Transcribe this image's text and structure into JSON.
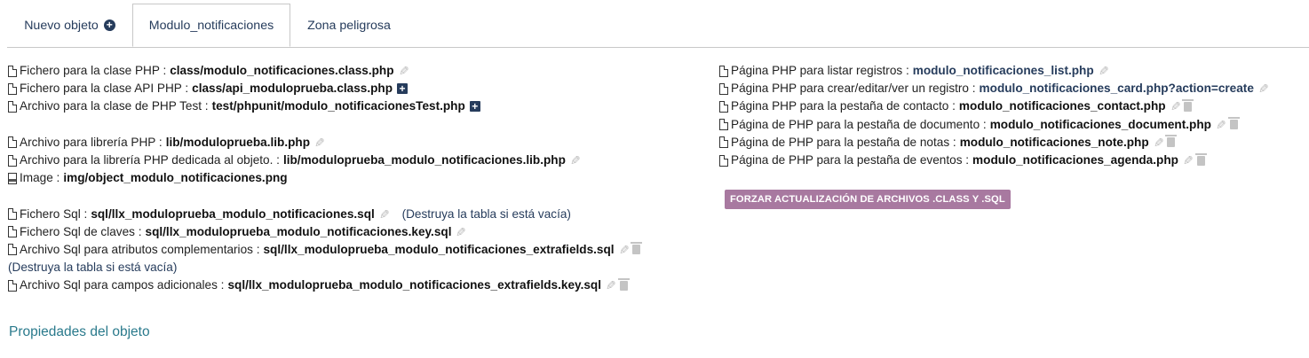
{
  "tabs": [
    {
      "label": "Nuevo objeto",
      "icon": "plus-circle-icon"
    },
    {
      "label": "Modulo_notificaciones",
      "active": true
    },
    {
      "label": "Zona peligrosa"
    }
  ],
  "left": {
    "class_php": {
      "label": "Fichero para la clase PHP :",
      "value": "class/modulo_notificaciones.class.php"
    },
    "class_api": {
      "label": "Fichero para la clase API PHP :",
      "value": "class/api_moduloprueba.class.php"
    },
    "class_test": {
      "label": "Archivo para la clase de PHP Test :",
      "value": "test/phpunit/modulo_notificacionesTest.php"
    },
    "lib": {
      "label": "Archivo para librería PHP :",
      "value": "lib/moduloprueba.lib.php"
    },
    "lib_obj": {
      "label": "Archivo para la librería PHP dedicada al objeto. :",
      "value": "lib/moduloprueba_modulo_notificaciones.lib.php"
    },
    "image": {
      "label": "Image :",
      "value": "img/object_modulo_notificaciones.png"
    },
    "sql": {
      "label": "Fichero Sql :",
      "value": "sql/llx_moduloprueba_modulo_notificaciones.sql",
      "note": "(Destruya la tabla si está vacía)"
    },
    "sql_key": {
      "label": "Fichero Sql de claves :",
      "value": "sql/llx_moduloprueba_modulo_notificaciones.key.sql"
    },
    "sql_extra": {
      "label": "Archivo Sql para atributos complementarios :",
      "value": "sql/llx_moduloprueba_modulo_notificaciones_extrafields.sql",
      "note": "(Destruya la tabla si está vacía)"
    },
    "sql_extra_key": {
      "label": "Archivo Sql para campos adicionales :",
      "value": "sql/llx_moduloprueba_modulo_notificaciones_extrafields.key.sql"
    }
  },
  "right": {
    "list": {
      "label": "Página PHP para listar registros :",
      "value": "modulo_notificaciones_list.php"
    },
    "card": {
      "label": "Página PHP para crear/editar/ver un registro :",
      "value": "modulo_notificaciones_card.php?action=create"
    },
    "contact": {
      "label": "Página PHP para la pestaña de contacto :",
      "value": "modulo_notificaciones_contact.php"
    },
    "document": {
      "label": "Página de PHP para la pestaña de documento :",
      "value": "modulo_notificaciones_document.php"
    },
    "note": {
      "label": "Página de PHP para la pestaña de notas :",
      "value": "modulo_notificaciones_note.php"
    },
    "agenda": {
      "label": "Página de PHP para la pestaña de eventos :",
      "value": "modulo_notificaciones_agenda.php"
    }
  },
  "force_button": "FORZAR ACTUALIZACIÓN DE ARCHIVOS .CLASS Y .SQL",
  "properties_title": "Propiedades del objeto",
  "colors": {
    "accent": "#263c5c",
    "button": "#a879a0",
    "props": "#2a7a8c"
  }
}
